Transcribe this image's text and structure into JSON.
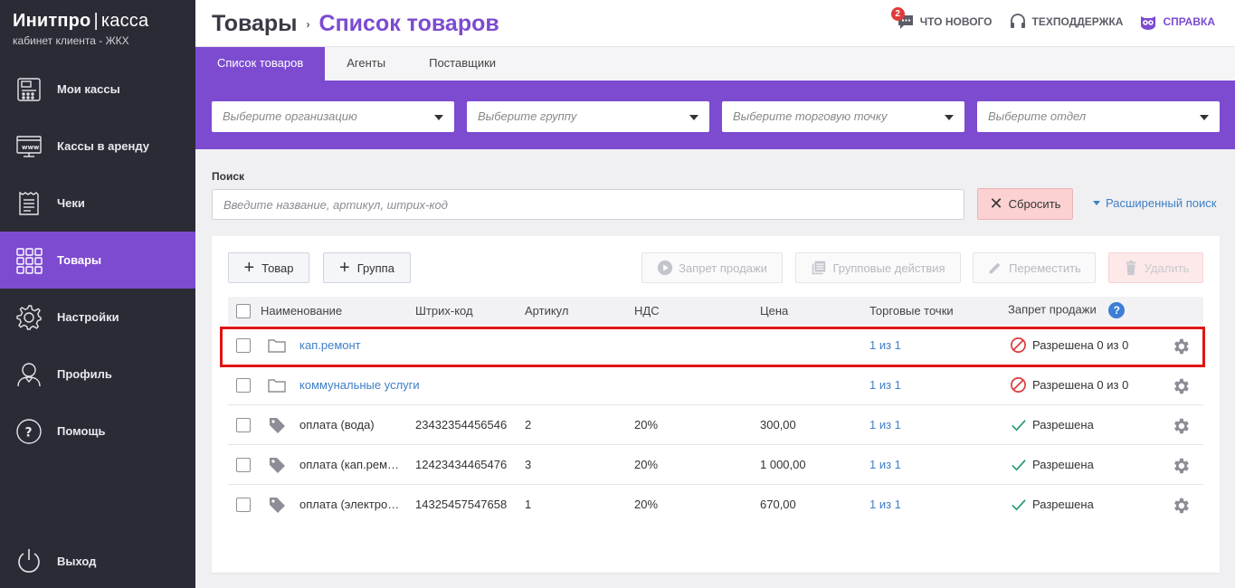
{
  "brand": {
    "title": "Инитпро",
    "separator": "|",
    "product": "касса",
    "subtitle": "кабинет клиента - ЖКХ"
  },
  "sidebar": {
    "items": [
      {
        "label": "Мои кассы",
        "icon": "cash-register-icon"
      },
      {
        "label": "Кассы в аренду",
        "icon": "www-monitor-icon"
      },
      {
        "label": "Чеки",
        "icon": "receipt-icon"
      },
      {
        "label": "Товары",
        "icon": "grid-icon",
        "active": true
      },
      {
        "label": "Настройки",
        "icon": "gear-icon"
      },
      {
        "label": "Профиль",
        "icon": "user-icon"
      },
      {
        "label": "Помощь",
        "icon": "question-icon"
      }
    ],
    "exit_label": "Выход"
  },
  "header": {
    "crumb_root": "Товары",
    "crumb_separator": "›",
    "crumb_current": "Список товаров",
    "whats_new": "ЧТО НОВОГО",
    "whats_new_badge": "2",
    "support": "ТЕХПОДДЕРЖКА",
    "help": "СПРАВКА"
  },
  "tabs": [
    {
      "label": "Список товаров",
      "active": true
    },
    {
      "label": "Агенты"
    },
    {
      "label": "Поставщики"
    }
  ],
  "filters": {
    "organization_placeholder": "Выберите организацию",
    "group_placeholder": "Выберите группу",
    "point_placeholder": "Выберите торговую точку",
    "department_placeholder": "Выберите отдел"
  },
  "search": {
    "label": "Поиск",
    "placeholder": "Введите название, артикул, штрих-код",
    "value": "",
    "reset_label": "Сбросить",
    "advanced_label": "Расширенный поиск"
  },
  "toolbar": {
    "add_product": "Товар",
    "add_group": "Группа",
    "sale_ban": "Запрет продажи",
    "group_actions": "Групповые действия",
    "move": "Переместить",
    "delete": "Удалить"
  },
  "table": {
    "columns": {
      "name": "Наименование",
      "barcode": "Штрих-код",
      "article": "Артикул",
      "vat": "НДС",
      "price": "Цена",
      "points": "Торговые точки",
      "sale_ban": "Запрет продажи",
      "help_glyph": "?"
    },
    "rows": [
      {
        "type": "group",
        "name": "кап.ремонт",
        "barcode": "",
        "article": "",
        "vat": "",
        "price": "",
        "points": "1 из 1",
        "status": "Разрешена 0 из 0",
        "status_kind": "blocked"
      },
      {
        "type": "group",
        "name": "коммунальные услуги",
        "barcode": "",
        "article": "",
        "vat": "",
        "price": "",
        "points": "1 из 1",
        "status": "Разрешена 0 из 0",
        "status_kind": "blocked"
      },
      {
        "type": "item",
        "name": "оплата (вода)",
        "barcode": "23432354456546",
        "article": "2",
        "vat": "20%",
        "price": "300,00",
        "points": "1 из 1",
        "status": "Разрешена",
        "status_kind": "allowed"
      },
      {
        "type": "item",
        "name": "оплата (кап.рем…",
        "barcode": "12423434465476",
        "article": "3",
        "vat": "20%",
        "price": "1 000,00",
        "points": "1 из 1",
        "status": "Разрешена",
        "status_kind": "allowed"
      },
      {
        "type": "item",
        "name": "оплата (электро…",
        "barcode": "14325457547658",
        "article": "1",
        "vat": "20%",
        "price": "670,00",
        "points": "1 из 1",
        "status": "Разрешена",
        "status_kind": "allowed"
      }
    ]
  },
  "colors": {
    "accent": "#7c4bd0",
    "sidebar_bg": "#2b2b36",
    "link": "#3f7fc7",
    "highlight": "#e01414",
    "allowed": "#2a9d6f",
    "blocked": "#e03a3a"
  }
}
